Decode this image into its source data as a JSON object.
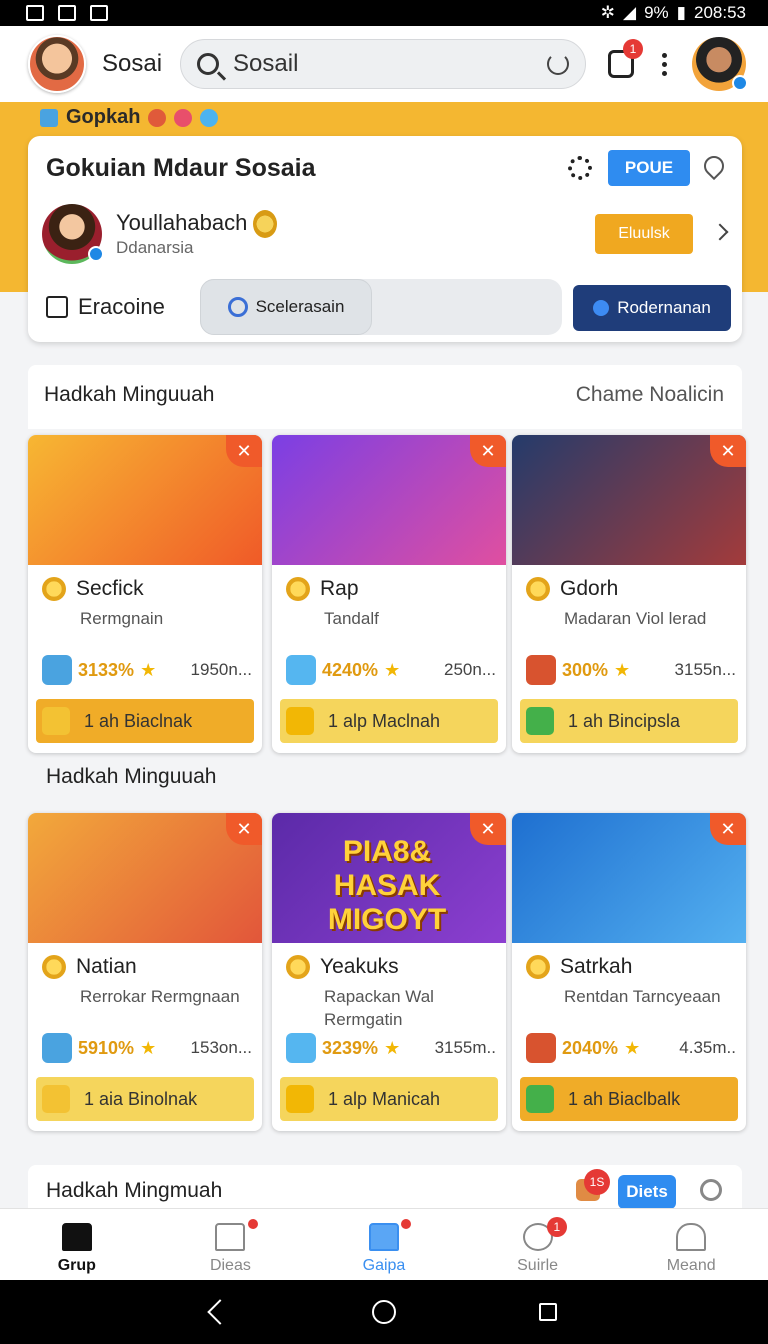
{
  "status_bar": {
    "battery_text": "9%",
    "time": "208:53"
  },
  "app_bar": {
    "title": "Sosai",
    "search_value": "Sosail",
    "notification_count": "1"
  },
  "banner": {
    "label": "Gopkah"
  },
  "profile_card": {
    "title": "Gokuian Mdaur Sosaia",
    "poue_label": "POUE",
    "name": "Youllahabach",
    "subtitle": "Ddanarsia",
    "action_label": "Eluulsk",
    "edit_label": "Eracoine",
    "segment_label": "Scelerasain",
    "primary_label": "Rodernanan"
  },
  "section1": {
    "title": "Hadkah Minguuah",
    "right_link": "Chame Noalicin"
  },
  "section2": {
    "title": "Hadkah Minguuah"
  },
  "section3": {
    "title": "Hadkah Mingmuah",
    "badge": "1S",
    "button_label": "Diets"
  },
  "row1": [
    {
      "title": "Secfick",
      "sub": "Rermgnain",
      "pct": "3133%",
      "count": "1950n...",
      "btn": "1 ah Biaclnak",
      "img_from": "#f7b733",
      "img_to": "#f05a28",
      "btn_style": "orange"
    },
    {
      "title": "Rap",
      "sub": "Tandalf",
      "pct": "4240%",
      "count": "250n...",
      "btn": "1 alp Maclnah",
      "img_from": "#7b3fe4",
      "img_to": "#e04fa0",
      "btn_style": "yellow"
    },
    {
      "title": "Gdorh",
      "sub": "Madaran Viol lerad",
      "pct": "300%",
      "count": "3155n...",
      "btn": "1 ah Bincipsla",
      "img_from": "#243b6b",
      "img_to": "#a33b3b",
      "btn_style": "yellow"
    }
  ],
  "row2": [
    {
      "title": "Natian",
      "sub": "Rerrokar Rermgnaan",
      "pct": "5910%",
      "count": "153on...",
      "btn": "1 aia Binolnak",
      "img_from": "#f2a93b",
      "img_to": "#e2563a",
      "btn_style": "yellow"
    },
    {
      "title": "Yeakuks",
      "sub": "Rapackan Wal Rermgatin",
      "pct": "3239%",
      "count": "3155m..",
      "btn": "1 alp Manicah",
      "img_from": "#5b2aa8",
      "img_to": "#8c3fd0",
      "btn_style": "yellow"
    },
    {
      "title": "Satrkah",
      "sub": "Rentdan Tarncyeaan",
      "pct": "2040%",
      "count": "4.35m..",
      "btn": "1 ah Biaclbalk",
      "img_from": "#1e6fd0",
      "img_to": "#54b0f0",
      "btn_style": "orange"
    }
  ],
  "row2_promo_text": "PIA8& HASAK MIGOYT",
  "bottom_nav": [
    {
      "label": "Grup",
      "state": "dark"
    },
    {
      "label": "Dieas",
      "state": "grey"
    },
    {
      "label": "Gaipa",
      "state": "blue"
    },
    {
      "label": "Suirle",
      "state": "grey",
      "badge": "1"
    },
    {
      "label": "Meand",
      "state": "grey"
    }
  ],
  "colors": {
    "accent_yellow": "#f4b731",
    "primary_blue": "#2f8cf0",
    "navy": "#1f3d7a",
    "badge_red": "#e53935"
  }
}
